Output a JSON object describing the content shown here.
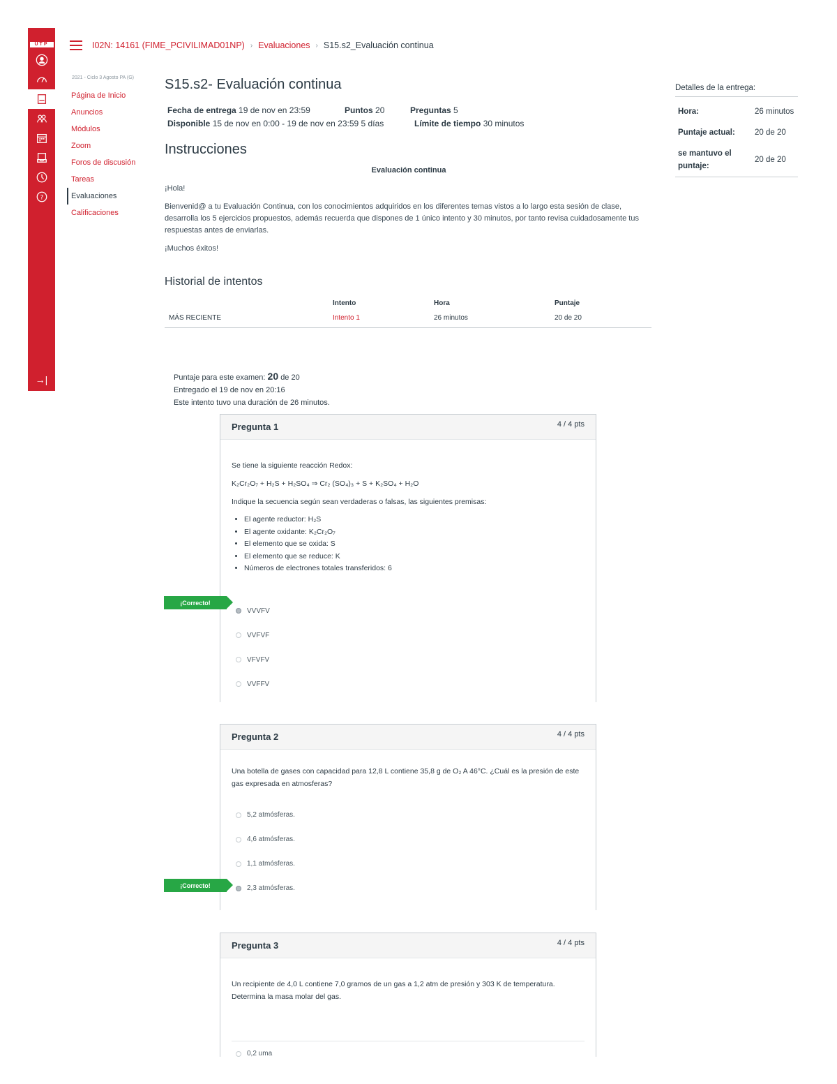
{
  "logo_text": "UTP",
  "breadcrumb": {
    "course": "I02N: 14161 (FIME_PCIVILIMAD01NP)",
    "section": "Evaluaciones",
    "current": "S15.s2_Evaluación continua"
  },
  "course_nav": {
    "term": "2021 - Ciclo 3 Agosto PA (G)",
    "items": [
      "Página de Inicio",
      "Anuncios",
      "Módulos",
      "Zoom",
      "Foros de discusión",
      "Tareas",
      "Evaluaciones",
      "Calificaciones"
    ]
  },
  "quiz": {
    "title": "S15.s2- Evaluación continua",
    "due_label": "Fecha de entrega",
    "due_value": "19 de nov en 23:59",
    "points_label": "Puntos",
    "points_value": "20",
    "questions_label": "Preguntas",
    "questions_value": "5",
    "available_label": "Disponible",
    "available_value": "15 de nov en 0:00 - 19 de nov en 23:59",
    "available_days": "5 días",
    "time_limit_label": "Límite de tiempo",
    "time_limit_value": "30 minutos"
  },
  "instructions": {
    "heading": "Instrucciones",
    "subheading": "Evaluación continua",
    "greeting": "¡Hola!",
    "body": "Bienvenid@ a tu Evaluación Continua, con los conocimientos adquiridos en los diferentes temas vistos a lo largo esta sesión de clase, desarrolla los 5 ejercicios propuestos, además recuerda que dispones de 1 único intento y 30 minutos, por tanto revisa cuidadosamente tus respuestas antes de enviarlas.",
    "closing": "¡Muchos éxitos!"
  },
  "history": {
    "heading": "Historial de intentos",
    "columns": [
      "",
      "Intento",
      "Hora",
      "Puntaje"
    ],
    "row": {
      "label": "MÁS RECIENTE",
      "attempt": "Intento 1",
      "time": "26 minutos",
      "score": "20 de 20"
    }
  },
  "summary": {
    "score_label": "Puntaje para este examen:",
    "score_value": "20",
    "score_suffix": "de 20",
    "submitted": "Entregado el 19 de nov en 20:16",
    "duration": "Este intento tuvo una duración de 26 minutos."
  },
  "details": {
    "heading": "Detalles de la entrega:",
    "rows": [
      {
        "key": "Hora:",
        "value": "26 minutos"
      },
      {
        "key": "Puntaje actual:",
        "value": "20 de 20"
      },
      {
        "key": "se mantuvo el puntaje:",
        "value": "20 de 20"
      }
    ]
  },
  "correct_label": "¡Correcto!",
  "questions": [
    {
      "name": "Pregunta 1",
      "points": "4 / 4 pts",
      "intro": "Se tiene la siguiente reacción Redox:",
      "reaction": "K₂Cr₂O₇ + H₂S + H₂SO₄ ⇒ Cr₂ (SO₄)₃ + S + K₂SO₄ + H₂O",
      "prompt": "Indique la secuencia según sean verdaderas o falsas, las siguientes premisas:",
      "premises": [
        "El agente reductor: H₂S",
        "El agente oxidante: K₂Cr₂O₇",
        "El elemento que se oxida: S",
        "El elemento que se reduce: K",
        "Números de electrones totales transferidos: 6"
      ],
      "options": [
        "VVVFV",
        "VVFVF",
        "VFVFV",
        "VVFFV"
      ]
    },
    {
      "name": "Pregunta 2",
      "points": "4 / 4 pts",
      "text": "Una botella de gases con capacidad para 12,8 L contiene 35,8 g de O₂ A 46°C. ¿Cuál es la presión de este gas expresada en atmosferas?",
      "options": [
        "5,2 atmósferas.",
        "4,6 atmósferas.",
        "1,1 atmósferas.",
        "2,3 atmósferas."
      ]
    },
    {
      "name": "Pregunta 3",
      "points": "4 / 4 pts",
      "text": "Un recipiente de 4,0 L contiene 7,0 gramos de un gas a 1,2 atm de presión y 303 K de temperatura. Determina la masa molar del gas.",
      "options": [
        "0,2 uma"
      ]
    }
  ]
}
